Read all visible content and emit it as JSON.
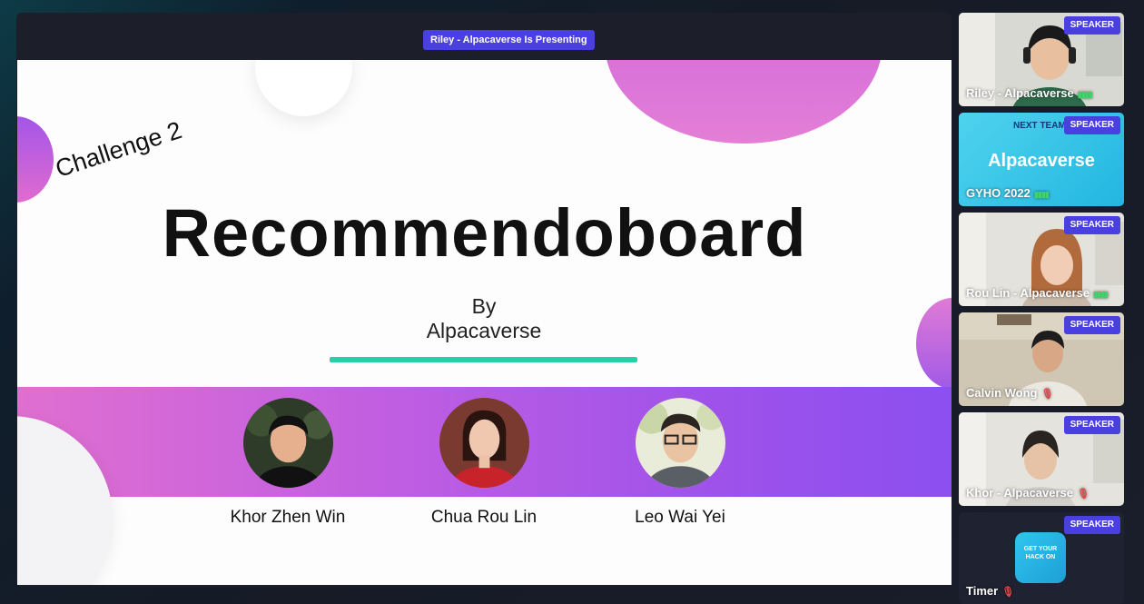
{
  "presenting_label": "Riley - Alpacaverse Is Presenting",
  "slide": {
    "challenge": "Challenge 2",
    "title": "Recommendoboard",
    "by_line1": "By",
    "by_line2": "Alpacaverse",
    "members": [
      {
        "name": "Khor Zhen Win"
      },
      {
        "name": "Chua Rou Lin"
      },
      {
        "name": "Leo Wai Yei"
      }
    ]
  },
  "participants": [
    {
      "name": "Riley - Alpacaverse",
      "badge": "SPEAKER",
      "mic": "on"
    },
    {
      "name": "GYHO 2022",
      "badge": "SPEAKER",
      "mic": "on",
      "tile_heading": "NEXT TEAM",
      "tile_title": "Alpacaverse"
    },
    {
      "name": "Rou Lin - Alpacaverse",
      "badge": "SPEAKER",
      "mic": "on"
    },
    {
      "name": "Calvin Wong",
      "badge": "SPEAKER",
      "mic": "off"
    },
    {
      "name": "Khor - Alpacaverse",
      "badge": "SPEAKER",
      "mic": "off"
    },
    {
      "name": "Timer",
      "badge": "SPEAKER",
      "mic": "off",
      "logo_text": "GET YOUR HACK ON"
    }
  ],
  "colors": {
    "badge": "#4a3fe0",
    "accent_bar": "#2bcfa7",
    "band_start": "#e06fd0",
    "band_end": "#8c4ff0"
  }
}
